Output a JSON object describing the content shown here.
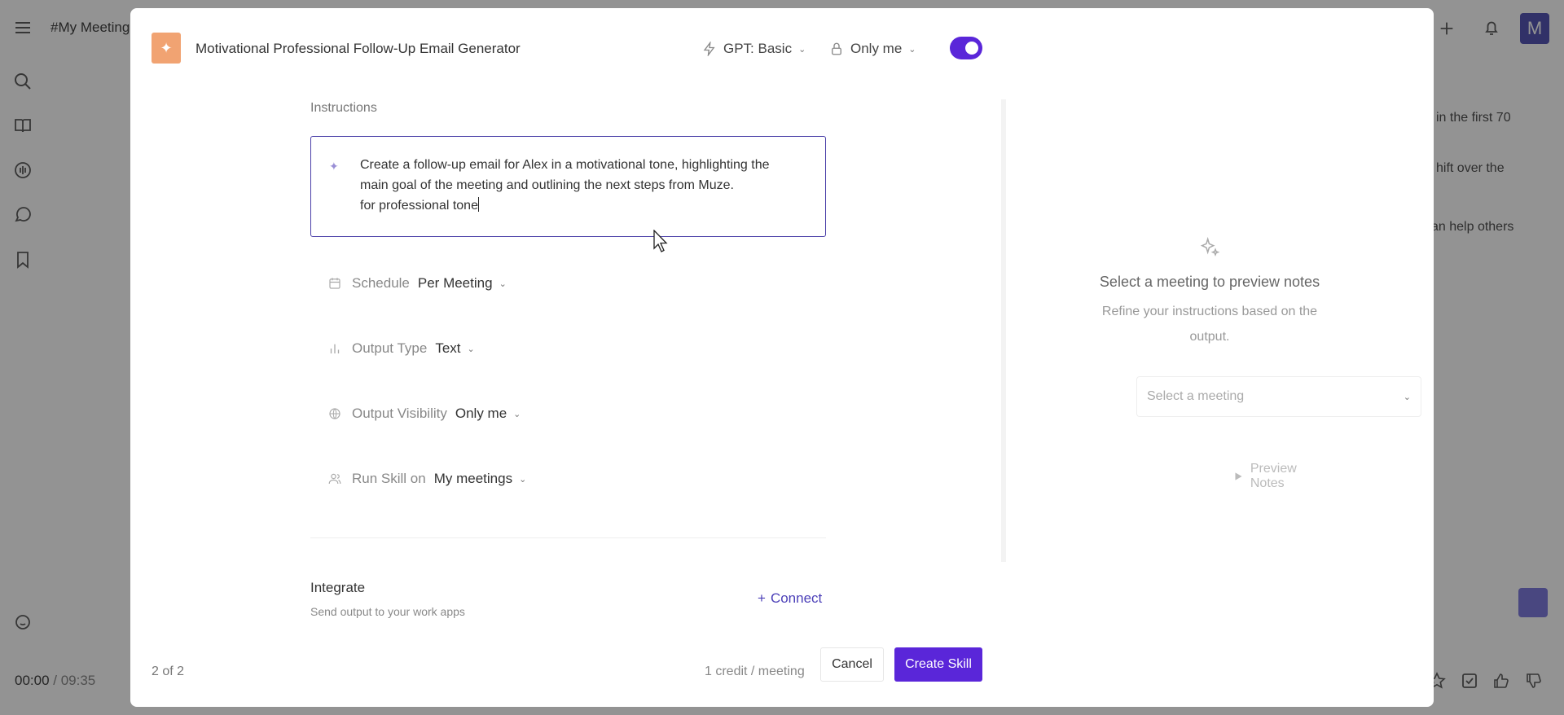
{
  "background": {
    "title": "#My Meeting",
    "snippets": [
      "in the first 70",
      "hift over the",
      "an help others"
    ],
    "time_current": "00:00",
    "time_separator": " / ",
    "time_total": "09:35",
    "avatar_letter": "M"
  },
  "modal": {
    "title": "Motivational Professional Follow-Up Email Generator",
    "model": "GPT: Basic",
    "privacy": "Only me",
    "toggle_on": true,
    "instructions": {
      "label": "Instructions",
      "lines": [
        "Create a follow-up email for Alex in a motivational tone, highlighting the",
        "main goal of the meeting and outlining the next steps from Muze.",
        "for professional tone"
      ]
    },
    "settings": [
      {
        "label": "Schedule",
        "value": "Per Meeting",
        "icon": "calendar-icon"
      },
      {
        "label": "Output Type",
        "value": "Text",
        "icon": "bar-chart-icon"
      },
      {
        "label": "Output Visibility",
        "value": "Only me",
        "icon": "globe-icon"
      },
      {
        "label": "Run Skill on",
        "value": "My meetings",
        "icon": "users-icon"
      }
    ],
    "integrate": {
      "title": "Integrate",
      "subtitle": "Send output to your work apps",
      "connect_label": "Connect"
    },
    "preview": {
      "title": "Select a meeting to preview notes",
      "subtitle": "Refine your instructions based on the output.",
      "select_placeholder": "Select a meeting",
      "button_label": "Preview Notes"
    },
    "footer": {
      "pager": "2 of 2",
      "credit": "1 credit / meeting",
      "cancel_label": "Cancel",
      "create_label": "Create Skill"
    }
  },
  "colors": {
    "accent": "#5a26d9",
    "logo": "#f1a372",
    "link": "#4b3fb8"
  }
}
